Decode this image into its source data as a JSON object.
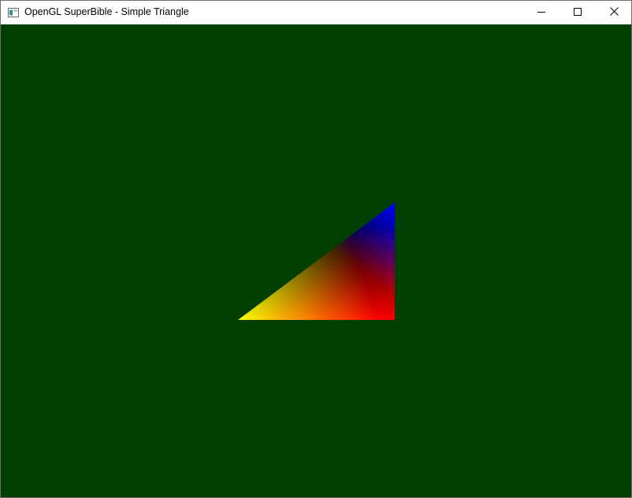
{
  "window": {
    "title": "OpenGL SuperBible - Simple Triangle",
    "icons": {
      "app": "application-window-icon",
      "minimize": "minimize-icon",
      "maximize": "maximize-icon",
      "close": "close-icon"
    }
  },
  "scene": {
    "clear_color": "#003f00",
    "triangle": {
      "vertex_colors": {
        "left": "#00ff00",
        "bottom_right": "#ff0000",
        "top_right": "#0000ff"
      }
    }
  }
}
